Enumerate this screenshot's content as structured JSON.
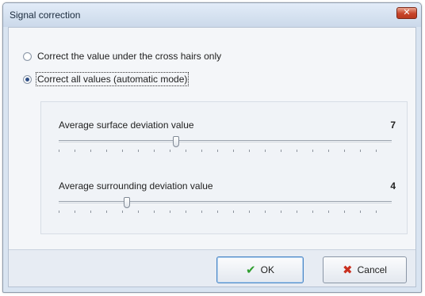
{
  "window": {
    "title": "Signal correction"
  },
  "controls": {
    "close_label": "✕"
  },
  "options": [
    {
      "label": "Correct the value under the cross hairs only",
      "checked": false
    },
    {
      "label": "Correct all values (automatic mode)",
      "checked": true
    }
  ],
  "sliders": [
    {
      "label": "Average surface deviation value",
      "value": "7",
      "min": 0,
      "max": 20
    },
    {
      "label": "Average surrounding deviation value",
      "value": "4",
      "min": 0,
      "max": 20
    }
  ],
  "buttons": {
    "ok": {
      "label": "OK",
      "icon": "check-icon"
    },
    "cancel": {
      "label": "Cancel",
      "icon": "x-icon"
    }
  },
  "colors": {
    "ok_icon": "#2f9e2f",
    "cancel_icon": "#c9301f",
    "radio_dot": "#2f4f86"
  }
}
